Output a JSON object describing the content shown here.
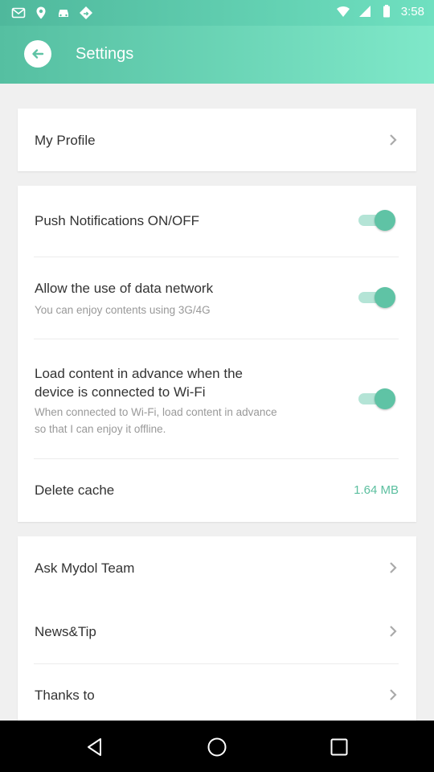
{
  "status_bar": {
    "time": "3:58",
    "icons": [
      "mail-icon",
      "maps-icon",
      "car-icon",
      "sign-icon",
      "wifi-icon",
      "signal-icon",
      "battery-icon"
    ]
  },
  "app_bar": {
    "title": "Settings"
  },
  "profile_card": {
    "my_profile_label": "My Profile"
  },
  "settings_card": {
    "push": {
      "label": "Push Notifications ON/OFF",
      "enabled": true
    },
    "data_network": {
      "label": "Allow the use of data network",
      "sub": "You can enjoy contents using 3G/4G",
      "enabled": true
    },
    "preload": {
      "label_line1": "Load content in advance when the",
      "label_line2": "device is connected to Wi-Fi",
      "sub_line1": "When connected to Wi-Fi, load content in advance",
      "sub_line2": "so that I can enjoy it offline.",
      "enabled": true
    },
    "cache": {
      "label": "Delete cache",
      "size": "1.64 MB"
    }
  },
  "info_card": {
    "ask_team": "Ask Mydol Team",
    "news_tip": "News&Tip",
    "thanks_to": "Thanks to"
  },
  "colors": {
    "accent": "#5fc3a5",
    "header_gradient_start": "#55bfa1",
    "header_gradient_end": "#7fe8c9"
  }
}
